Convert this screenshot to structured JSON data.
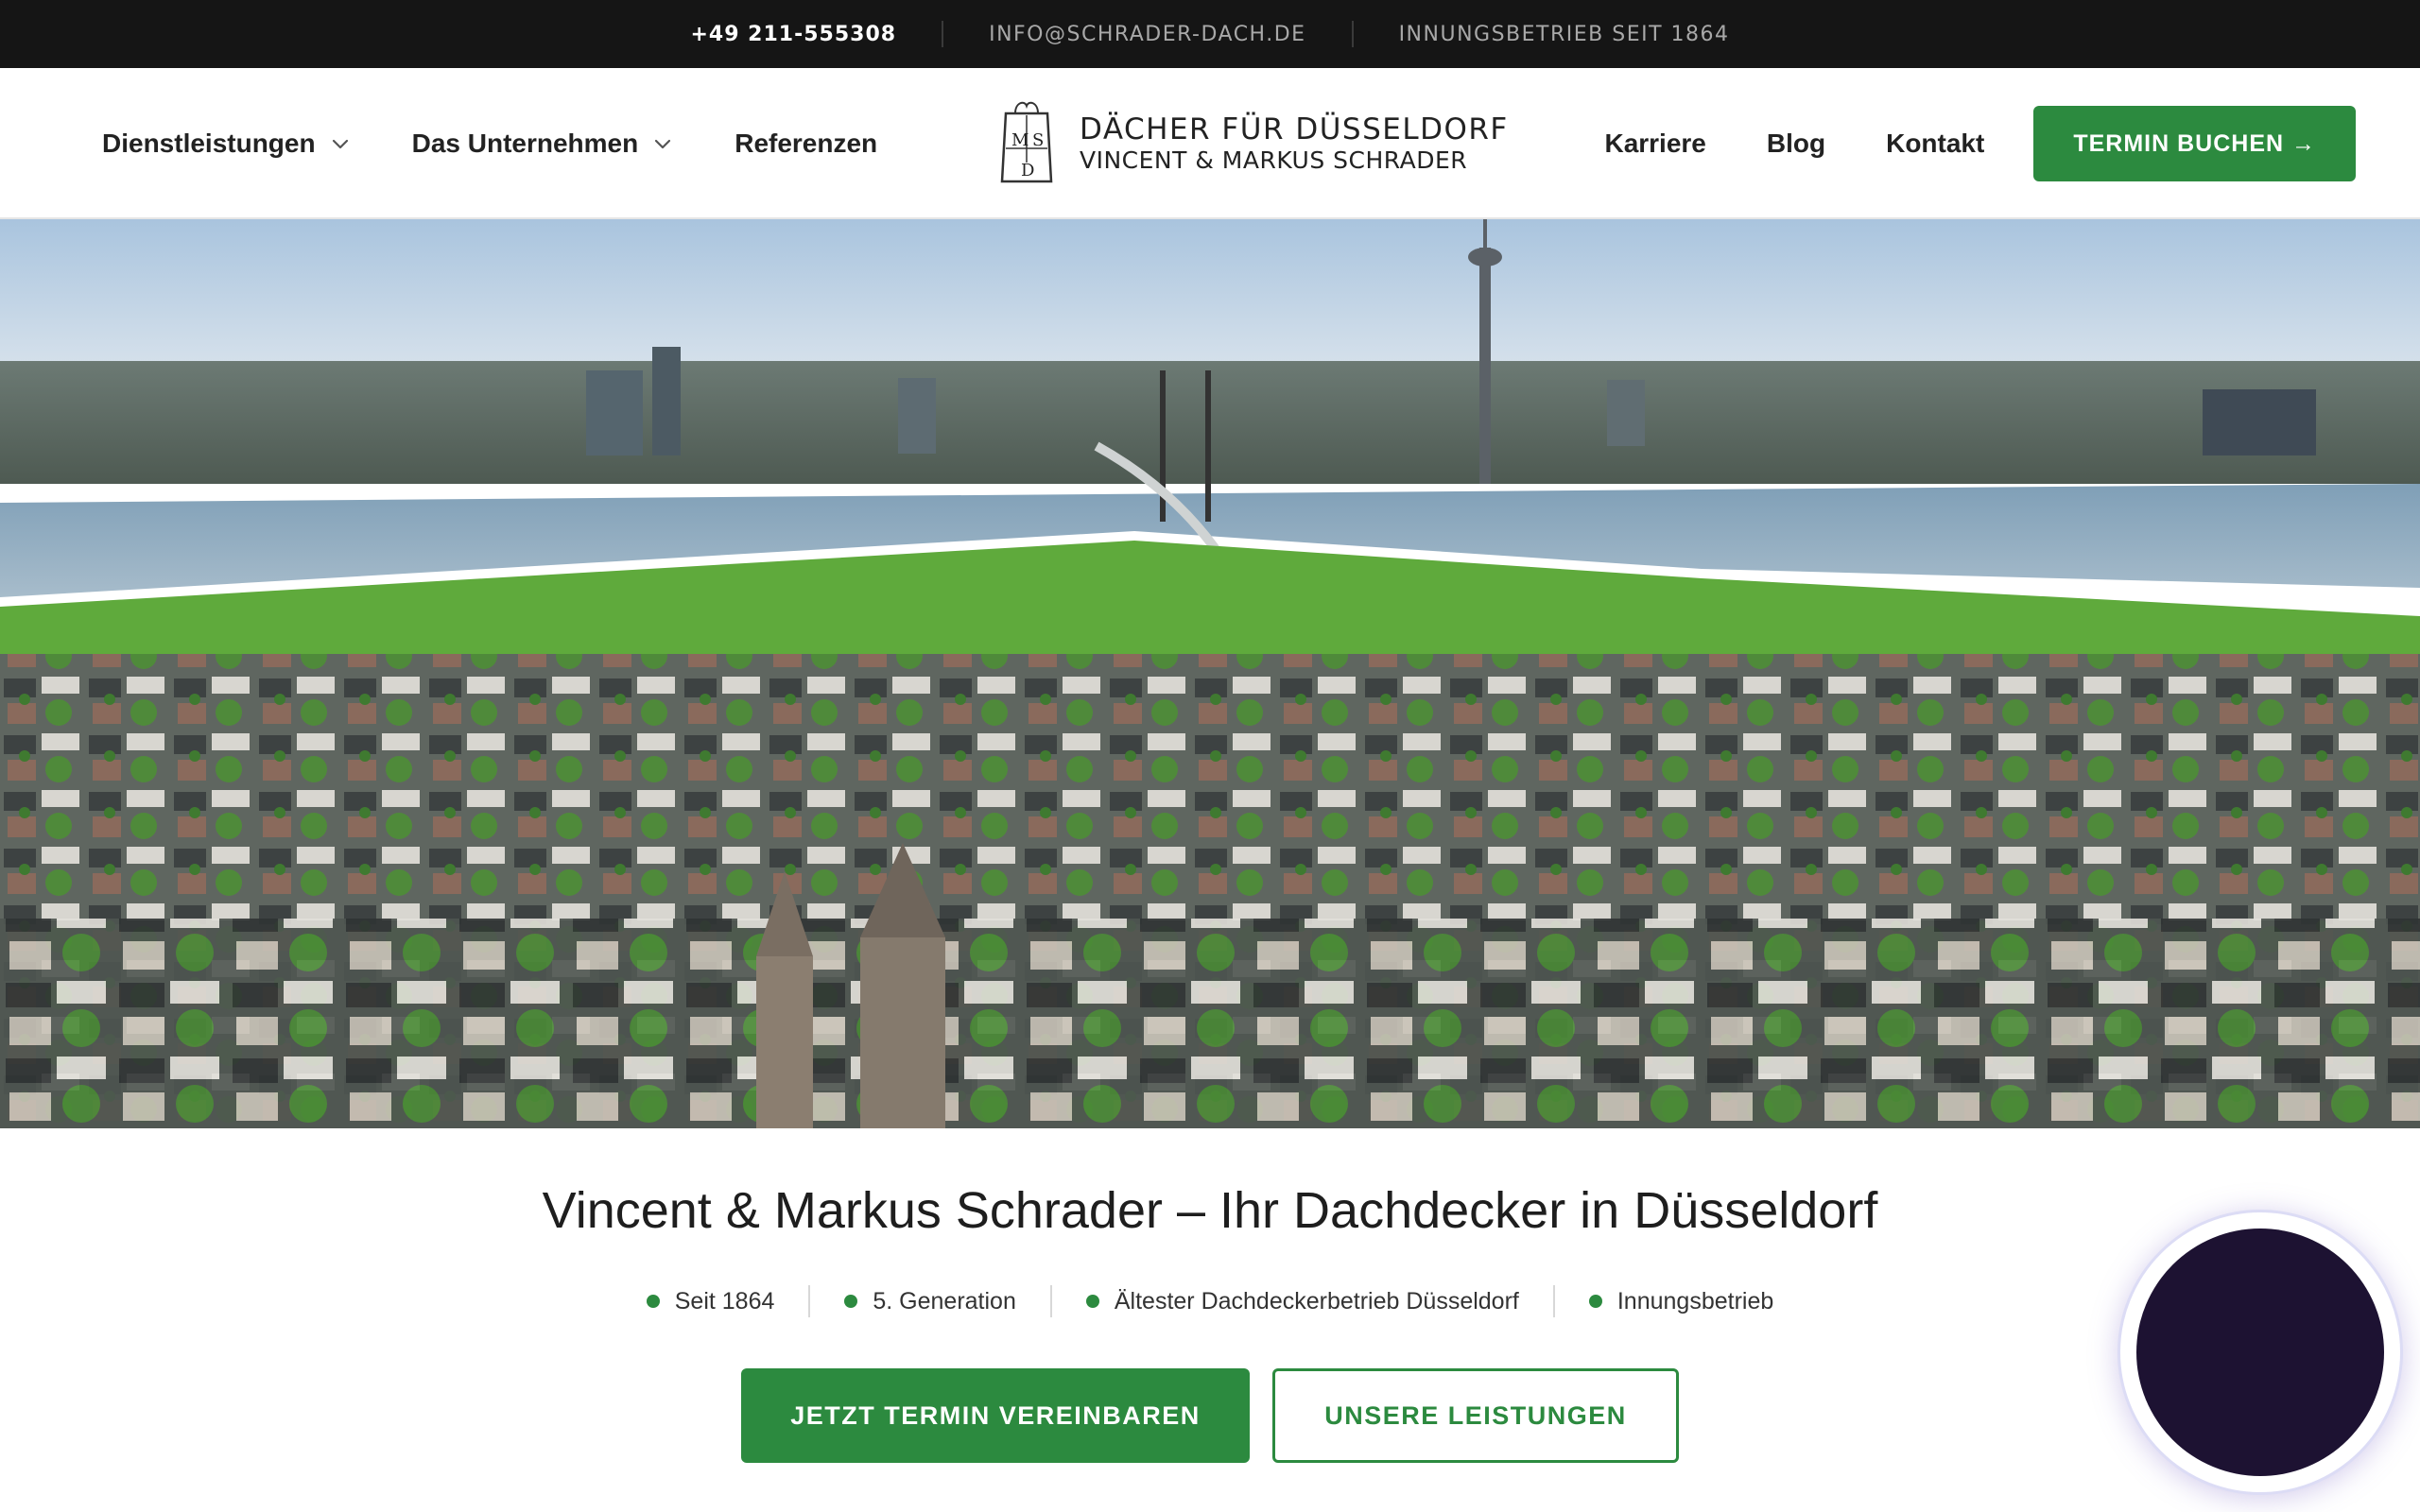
{
  "topbar": {
    "phone": "+49 211-555308",
    "email": "INFO@SCHRADER-DACH.DE",
    "since": "INNUNGSBETRIEB SEIT 1864"
  },
  "nav": {
    "left": [
      {
        "label": "Dienstleistungen",
        "dropdown": true
      },
      {
        "label": "Das Unternehmen",
        "dropdown": true
      },
      {
        "label": "Referenzen",
        "dropdown": false
      }
    ],
    "right": [
      {
        "label": "Karriere"
      },
      {
        "label": "Blog"
      },
      {
        "label": "Kontakt"
      }
    ],
    "cta": "TERMIN BUCHEN →"
  },
  "logo": {
    "line1": "DÄCHER FÜR DÜSSELDORF",
    "line2": "VINCENT & MARKUS SCHRADER",
    "monogram": [
      "M",
      "S",
      "D"
    ]
  },
  "hero": {
    "image": "aerial-city-view-duesseldorf-rhine"
  },
  "main": {
    "headline": "Vincent & Markus Schrader – Ihr Dachdecker in Düsseldorf",
    "features": [
      "Seit 1864",
      "5. Generation",
      "Ältester Dachdeckerbetrieb Düsseldorf",
      "Innungsbetrieb"
    ],
    "primary_button": "JETZT TERMIN VEREINBAREN",
    "secondary_button": "UNSERE LEISTUNGEN"
  },
  "colors": {
    "accent": "#2c8a3f",
    "topbar_bg": "#151515",
    "chat_widget": "#1d1232"
  }
}
